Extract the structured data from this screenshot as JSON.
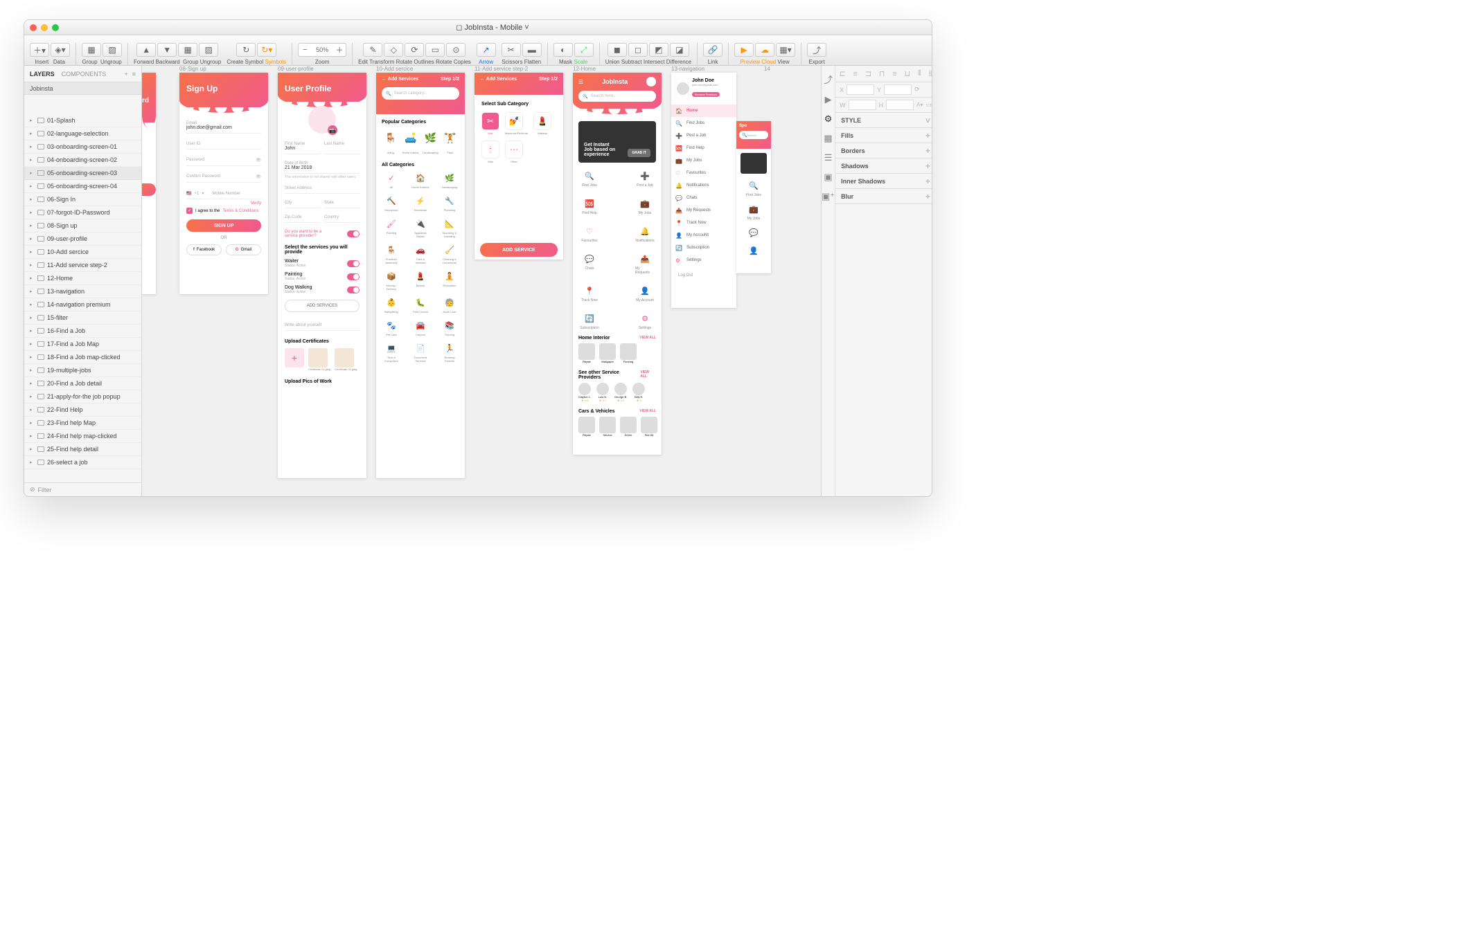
{
  "title": "JobInsta - Mobile",
  "toolbar": {
    "insert": "Insert",
    "data": "Data",
    "group": "Group",
    "ungroup": "Ungroup",
    "forward": "Forward",
    "backward": "Backward",
    "group2": "Group",
    "ungroup2": "Ungroup",
    "createSymbol": "Create Symbol",
    "symbols": "Symbols",
    "zoom": "Zoom",
    "zoomVal": "50%",
    "edit": "Edit",
    "transform": "Transform",
    "rotate": "Rotate",
    "outlines": "Outlines",
    "rotateCopies": "Rotate Copies",
    "arrow": "Arrow",
    "scissors": "Scissors",
    "flatten": "Flatten",
    "mask": "Mask",
    "scale": "Scale",
    "union": "Union",
    "subtract": "Subtract",
    "intersect": "Intersect",
    "difference": "Difference",
    "link": "Link",
    "preview": "Preview",
    "cloud": "Cloud",
    "view": "View",
    "export": "Export"
  },
  "leftTabs": {
    "layers": "LAYERS",
    "components": "COMPONENTS"
  },
  "crumb": "Jobinsta",
  "layers": [
    "01-Splash",
    "02-language-selection",
    "03-onboarding-screen-01",
    "04-onboarding-screen-02",
    "05-onboarding-screen-03",
    "05-onboarding-screen-04",
    "06-Sign In",
    "07-forgot-ID-Password",
    "08-Sign up",
    "09-user-profile",
    "10-Add sercice",
    "11-Add service step-2",
    "12-Home",
    "13-navigation",
    "14-navigation premium",
    "15-filter",
    "16-Find a Job",
    "17-Find a Job Map",
    "18-Find a Job map-clicked",
    "19-multiple-jobs",
    "20-Find a Job detail",
    "21-apply-for-the job popup",
    "22-Find Help",
    "23-Find help Map",
    "24-Find help map-clicked",
    "25-Find help detail",
    "26-select a job"
  ],
  "filter": "Filter",
  "artLabels": {
    "a08": "08-Sign up",
    "a09": "09-user-profile",
    "a10": "10-Add sercice",
    "a11": "11-Add service step-2",
    "a12": "12-Home",
    "a13": "13-navigation",
    "a14": "14"
  },
  "signup": {
    "title": "Sign Up",
    "email": "Email",
    "emailVal": "john.doe@gmail.com",
    "userid": "User ID",
    "password": "Password",
    "confirm": "Confirm Password",
    "country": "+1",
    "mobile": "Mobile Number",
    "verify": "Verify",
    "agree": "I agree to the",
    "terms": "Terms & Conditions",
    "btn": "SIGN UP",
    "or": "OR",
    "fb": "Facebook",
    "gm": "Gmail"
  },
  "profile": {
    "title": "User Profile",
    "first": "First Name",
    "firstVal": "John",
    "last": "Last Name",
    "dob": "Date of Birth",
    "dobVal": "21 Mar 2018",
    "note": "This information is not shared with other users",
    "street": "Street Address",
    "city": "City",
    "state": "State",
    "zip": "Zip Code",
    "country": "Country",
    "provider": "Do you want to be a service provider?",
    "servicesTitle": "Select the services you will provide",
    "svc": [
      {
        "n": "Waiter",
        "s": "Status: Active"
      },
      {
        "n": "Painting",
        "s": "Status: Active"
      },
      {
        "n": "Dog Walking",
        "s": "Status: Active"
      }
    ],
    "addBtn": "ADD SERVICES",
    "about": "Write about yourself",
    "cert": "Upload Certificates",
    "c1": "Certificate 01.jpeg",
    "c2": "Certificate 02.jpeg",
    "pics": "Upload Pics of Work"
  },
  "addService": {
    "title": "Add Services",
    "step": "Step 1/2",
    "search": "Search category...",
    "pop": "Popular Categories",
    "popc": [
      {
        "n": "oning"
      },
      {
        "n": "Home Interior"
      },
      {
        "n": "Landscaping"
      },
      {
        "n": "Fitne"
      }
    ],
    "all": "All Categories",
    "cats": [
      "All",
      "Home Exterior",
      "Landscaping",
      "Handyman",
      "Electrician",
      "Plumbing",
      "Painting",
      "Appliance Repair",
      "Mounting & Installing",
      "Furniture Assembly",
      "Cars & Vehicles",
      "Cleaning & Housework",
      "Moving / Delivery",
      "Beauty",
      "Relaxation",
      "Babysitting",
      "Pest Control",
      "Adult Care",
      "Pet Care",
      "Carpool",
      "Tutoring",
      "Tech & Computers",
      "Document Services",
      "Running Errands"
    ]
  },
  "addStep2": {
    "title": "Add Services",
    "step": "Step 1/2",
    "sub": "Select Sub Category",
    "items": [
      "Hair",
      "Manicure/Pedicure",
      "Makeup",
      "Wax",
      "Other"
    ],
    "btn": "ADD SERVICE"
  },
  "home": {
    "brand": "JobInsta",
    "search": "Search here...",
    "heroTitle": "Get Instant Job based on experience",
    "heroBtn": "GRAB IT",
    "grid": [
      "Find Jobs",
      "Post a Job",
      "Find Help",
      "My Jobs",
      "Favourites",
      "Notifications",
      "Chats",
      "My Requests",
      "Track Now",
      "My Account",
      "Subscription",
      "Settings"
    ],
    "sec1": "Home Interior",
    "viewAll": "VIEW ALL",
    "rep": "Repair",
    "wall": "Wallpaper",
    "floor": "Flooring",
    "sec2": "See other Service Providers",
    "p": [
      {
        "n": "Clayton L.",
        "r": "4.9"
      },
      {
        "n": "Luis N.",
        "r": "4.7"
      },
      {
        "n": "George B.",
        "r": "4.2"
      },
      {
        "n": "Billy E.",
        "r": "4"
      }
    ],
    "sec3": "Cars & Vehicles",
    "c": [
      "Repair",
      "Service",
      "Driver",
      "See All"
    ]
  },
  "nav": {
    "name": "John Doe",
    "email": "john.doe@gmail.com",
    "premium": "Become Premium",
    "items": [
      "Home",
      "Find Jobs",
      "Post a Job",
      "Find Help",
      "My Jobs",
      "Favourites",
      "Notifications",
      "Chats",
      "My Requests",
      "Track Now",
      "My AccouNt",
      "Subscription",
      "Settings"
    ],
    "logout": "Log Out"
  },
  "peek": {
    "spo": "Spo",
    "search": "Search",
    "find": "Find Jobs",
    "my": "My Jobs"
  },
  "inspector": {
    "style": "STYLE",
    "fills": "Fills",
    "borders": "Borders",
    "shadows": "Shadows",
    "inner": "Inner Shadows",
    "blur": "Blur",
    "x": "X",
    "y": "Y",
    "w": "W",
    "h": "H"
  }
}
